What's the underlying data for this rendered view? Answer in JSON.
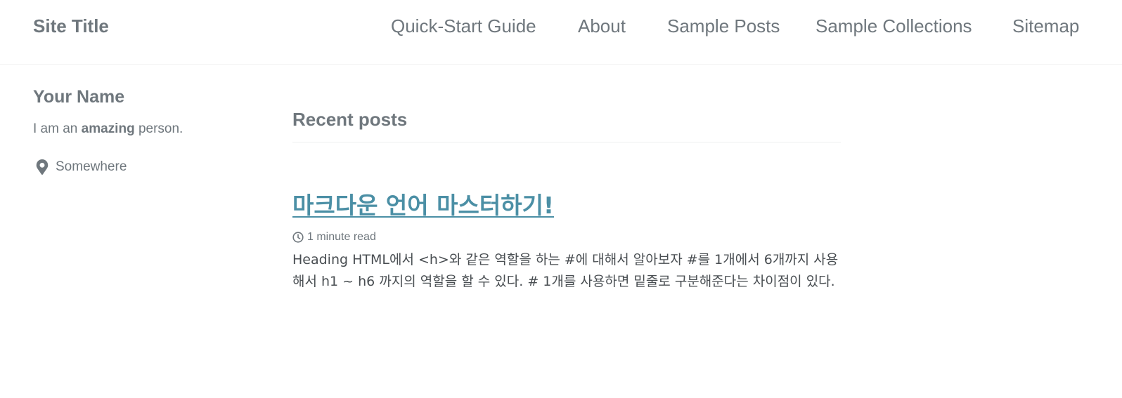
{
  "masthead": {
    "site_title": "Site Title",
    "nav": [
      {
        "label": "Quick-Start Guide"
      },
      {
        "label": "About"
      },
      {
        "label": "Sample Posts"
      },
      {
        "label": "Sample Collections"
      },
      {
        "label": "Sitemap"
      }
    ]
  },
  "author": {
    "name": "Your Name",
    "bio_prefix": "I am an ",
    "bio_bold": "amazing",
    "bio_suffix": " person.",
    "location": "Somewhere",
    "location_icon": "map-marker-icon"
  },
  "main": {
    "heading": "Recent posts",
    "posts": [
      {
        "title": "마크다운 언어 마스터하기!",
        "read_time": "1 minute read",
        "read_time_icon": "clock-icon",
        "excerpt": "Heading HTML에서 <h>와 같은 역할을 하는 #에 대해서 알아보자 #를 1개에서 6개까지 사용해서 h1 ~ h6 까지의 역할을 할 수 있다. # 1개를 사용하면 밑줄로 구분해준다는 차이점이 있다."
      }
    ]
  },
  "colors": {
    "text_muted": "#6f777d",
    "text_body": "#494e52",
    "link": "#4b8fa5",
    "border": "#f2f3f3"
  }
}
